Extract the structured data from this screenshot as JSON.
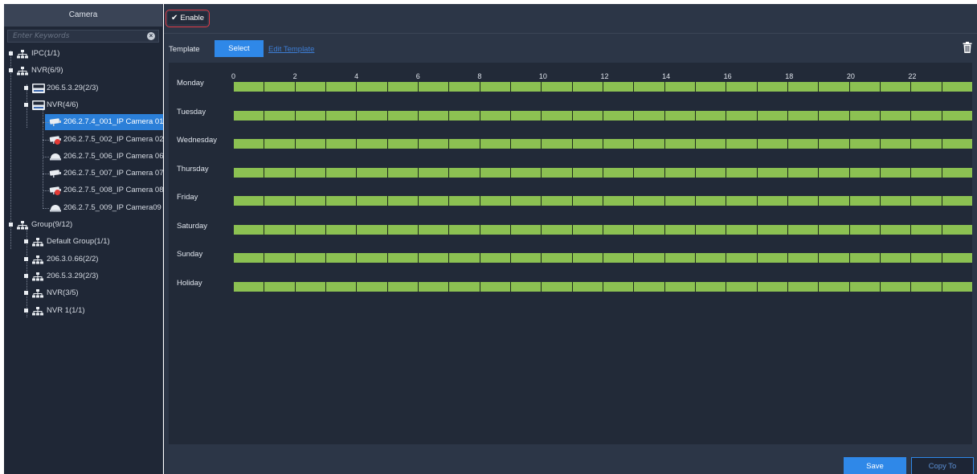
{
  "sidebar": {
    "title": "Camera",
    "search_placeholder": "Enter Keywords",
    "tree": [
      {
        "label": "IPC(1/1)",
        "icon": "network-icon",
        "level": 0
      },
      {
        "label": "NVR(6/9)",
        "icon": "network-icon",
        "level": 0
      },
      {
        "label": "206.5.3.29(2/3)",
        "icon": "nvr-icon",
        "level": 1
      },
      {
        "label": "NVR(4/6)",
        "icon": "nvr-icon",
        "level": 1
      },
      {
        "label": "206.2.7.4_001_IP Camera 01",
        "icon": "camera-icon",
        "level": 2,
        "selected": true
      },
      {
        "label": "206.2.7.5_002_IP Camera 02",
        "icon": "camera-offline-icon",
        "level": 2
      },
      {
        "label": "206.2.7.5_006_IP Camera 06",
        "icon": "dome-camera-icon",
        "level": 2
      },
      {
        "label": "206.2.7.5_007_IP Camera 07",
        "icon": "camera-icon",
        "level": 2
      },
      {
        "label": "206.2.7.5_008_IP Camera 08",
        "icon": "camera-offline-icon",
        "level": 2
      },
      {
        "label": "206.2.7.5_009_IP Camera09",
        "icon": "dome-camera-icon",
        "level": 2
      },
      {
        "label": "Group(9/12)",
        "icon": "network-icon",
        "level": 0
      },
      {
        "label": "Default Group(1/1)",
        "icon": "network-icon",
        "level": 1
      },
      {
        "label": "206.3.0.66(2/2)",
        "icon": "network-icon",
        "level": 1
      },
      {
        "label": "206.5.3.29(2/3)",
        "icon": "network-icon",
        "level": 1
      },
      {
        "label": "NVR(3/5)",
        "icon": "network-icon",
        "level": 1
      },
      {
        "label": "NVR 1(1/1)",
        "icon": "network-icon",
        "level": 1
      }
    ]
  },
  "main": {
    "enable_label": "Enable",
    "enable_checked": true,
    "template_label": "Template",
    "select_label": "Select",
    "edit_template_label": "Edit Template",
    "delete_icon": "trash-icon",
    "hours": [
      "0",
      "2",
      "4",
      "6",
      "8",
      "10",
      "12",
      "14",
      "16",
      "18",
      "20",
      "22"
    ],
    "days": [
      "Monday",
      "Tuesday",
      "Wednesday",
      "Thursday",
      "Friday",
      "Saturday",
      "Sunday",
      "Holiday"
    ],
    "bar_segments": 24,
    "bar_color": "#8cc152",
    "save_label": "Save",
    "copy_label": "Copy To"
  },
  "colors": {
    "accent": "#2f88e8",
    "selected_row": "#2b7fd8",
    "highlight_border": "#e03a44"
  }
}
